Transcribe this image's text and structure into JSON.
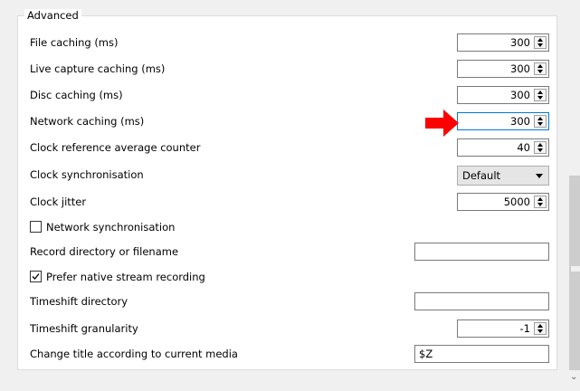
{
  "group": {
    "title": "Advanced"
  },
  "rows": [
    {
      "label": "File caching (ms)",
      "value": "300"
    },
    {
      "label": "Live capture caching (ms)",
      "value": "300"
    },
    {
      "label": "Disc caching (ms)",
      "value": "300"
    },
    {
      "label": "Network caching (ms)",
      "value": "300"
    },
    {
      "label": "Clock reference average counter",
      "value": "40"
    }
  ],
  "clock_sync": {
    "label": "Clock synchronisation",
    "value": "Default"
  },
  "clock_jitter": {
    "label": "Clock jitter",
    "value": "5000"
  },
  "network_sync": {
    "label": "Network synchronisation",
    "checked": false
  },
  "record_dir": {
    "label": "Record directory or filename",
    "value": ""
  },
  "native_recording": {
    "label": "Prefer native stream recording",
    "checked": true
  },
  "timeshift_dir": {
    "label": "Timeshift directory",
    "value": ""
  },
  "timeshift_gran": {
    "label": "Timeshift granularity",
    "value": "-1"
  },
  "change_title": {
    "label": "Change title according to current media",
    "value": "$Z"
  },
  "colors": {
    "annotation_arrow": "#ff0000",
    "focus_border": "#0078d7"
  }
}
